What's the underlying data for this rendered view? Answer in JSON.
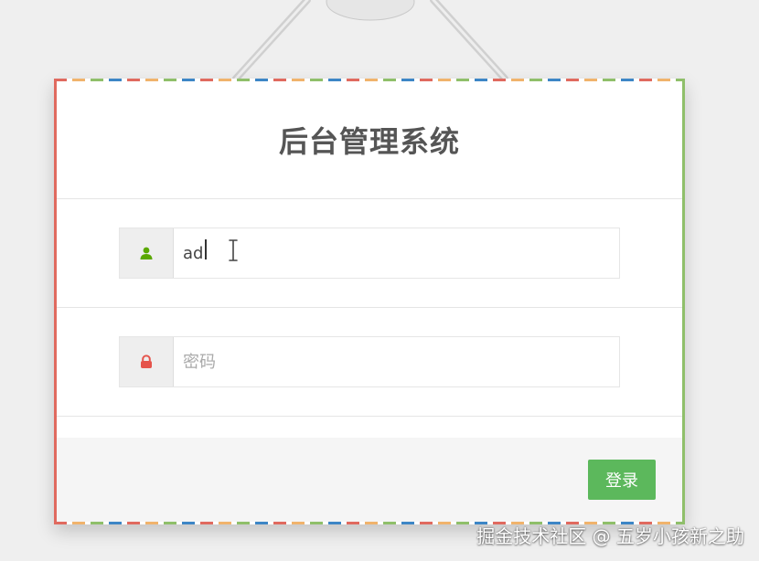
{
  "page": {
    "title": "后台管理系统"
  },
  "form": {
    "username_value": "ad",
    "password_placeholder": "密码"
  },
  "buttons": {
    "login_label": "登录"
  },
  "colors": {
    "accent_green": "#5cb85c",
    "user_icon": "#5aa800",
    "lock_icon": "#e5534b"
  },
  "watermark": {
    "text": "掘金技术社区 @ 五岁小孩新之助"
  }
}
